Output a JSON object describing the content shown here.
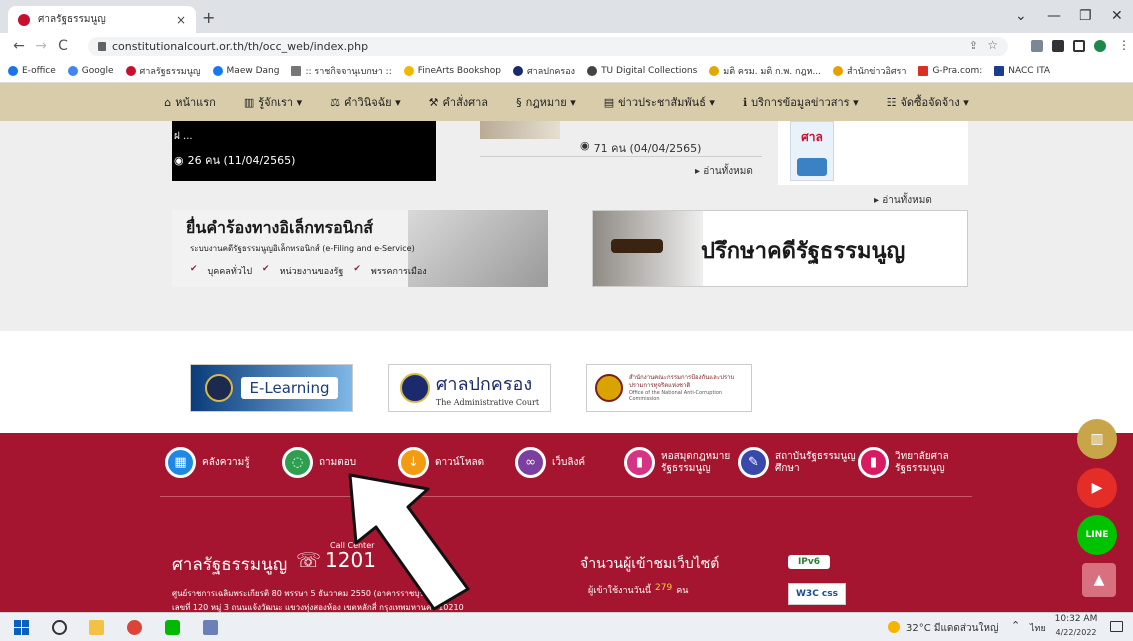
{
  "tab": {
    "title": "ศาลรัฐธรรมนูญ",
    "close": "×",
    "new": "+"
  },
  "window": {
    "minimize": "—",
    "restore": "❐",
    "close": "✕",
    "dropdown": "⌄"
  },
  "address": {
    "url": "constitutionalcourt.or.th/th/occ_web/index.php",
    "back": "←",
    "forward": "→",
    "reload": "C",
    "star": "☆",
    "share": "⇪"
  },
  "bookmarks": [
    {
      "label": "E-office",
      "color": "#1a73e8"
    },
    {
      "label": "Google",
      "color": "#4285f4"
    },
    {
      "label": "ศาลรัฐธรรมนูญ",
      "color": "#c8102e"
    },
    {
      "label": "Maew Dang",
      "color": "#1877f2"
    },
    {
      "label": ":: ราชกิจจานุเบกษา ::",
      "color": "#777777"
    },
    {
      "label": "FineArts Bookshop",
      "color": "#f2b700"
    },
    {
      "label": "ศาลปกครอง",
      "color": "#1a2a6c"
    },
    {
      "label": "TU Digital Collections",
      "color": "#444444"
    },
    {
      "label": "มติ ครม. มติ ก.พ. กฎห...",
      "color": "#e0a800"
    },
    {
      "label": "สำนักข่าวอิศรา",
      "color": "#e8a000"
    },
    {
      "label": "G-Pra.com:",
      "color": "#d93025"
    },
    {
      "label": "NACC ITA",
      "color": "#1a3d8f"
    }
  ],
  "menu": [
    {
      "label": "หน้าแรก",
      "icon": "home-icon",
      "glyph": "⌂"
    },
    {
      "label": "รู้จักเรา ▾",
      "icon": "building-icon",
      "glyph": "▥"
    },
    {
      "label": "คำวินิจฉัย ▾",
      "icon": "scales-icon",
      "glyph": "⚖"
    },
    {
      "label": "คำสั่งศาล",
      "icon": "gavel-icon",
      "glyph": "⚒"
    },
    {
      "label": "กฎหมาย ▾",
      "icon": "law-icon",
      "glyph": "§"
    },
    {
      "label": "ข่าวประชาสัมพันธ์ ▾",
      "icon": "news-icon",
      "glyph": "▤"
    },
    {
      "label": "บริการข้อมูลข่าวสาร ▾",
      "icon": "info-icon",
      "glyph": "ℹ"
    },
    {
      "label": "จัดซื้อจัดจ้าง ▾",
      "icon": "procure-icon",
      "glyph": "☷"
    }
  ],
  "news": {
    "left_views": "26 คน (11/04/2565)",
    "left_trunc": "ฝ ...",
    "mid_views": "71 คน (04/04/2565)",
    "mid_readmore": "▸ อ่านทั้งหมด",
    "right_readmore": "▸ อ่านทั้งหมด",
    "book_title": "ศาล"
  },
  "banner_left": {
    "title": "ยื่นคำร้องทางอิเล็กทรอนิกส์",
    "subtitle": "ระบบงานคดีรัฐธรรมนูญอิเล็กทรอนิกส์ (e-Filing and e-Service)",
    "opts": [
      "บุคคลทั่วไป",
      "หน่วยงานของรัฐ",
      "พรรคการเมือง"
    ]
  },
  "banner_right": {
    "title": "ปรึกษาคดีรัฐธรรมนูญ"
  },
  "logos": {
    "elearning": "E-Learning",
    "admin_th": "ศาลปกครอง",
    "admin_en": "The Administrative Court",
    "nacc_th": "สำนักงานคณะกรรมการป้องกันและปราบปรามการทุจริตแห่งชาติ",
    "nacc_en": "Office of the National Anti-Corruption Commission"
  },
  "quick": [
    {
      "label": "คลังความรู้",
      "color": "#1e88e5",
      "glyph": "▦"
    },
    {
      "label": "ถามตอบ",
      "color": "#2e9e4f",
      "glyph": "◌"
    },
    {
      "label": "ดาวน์โหลด",
      "color": "#f39c12",
      "glyph": "↓"
    },
    {
      "label": "เว็บลิงค์",
      "color": "#7b3fa0",
      "glyph": "∞"
    },
    {
      "label": "หอสมุดกฎหมายรัฐธรรมนูญ",
      "color": "#d63384",
      "glyph": "▮"
    },
    {
      "label": "สถาบันรัฐธรรมนูญศึกษา",
      "color": "#3949ab",
      "glyph": "✎"
    },
    {
      "label": "วิทยาลัยศาลรัฐธรรมนูญ",
      "color": "#d81b60",
      "glyph": "▮"
    }
  ],
  "footer": {
    "name": "ศาลรัฐธรรมนูญ",
    "callcenter_label": "Call Center",
    "callcenter_num": "1201",
    "addr1": "ศูนย์ราชการเฉลิมพระเกียรติ 80 พรรษา 5 ธันวาคม 2550 (อาคารราชบุรีดิเรกฤทธิ์)",
    "addr2": "เลขที่ 120 หมู่ 3 ถนนแจ้งวัฒนะ แขวงทุ่งสองห้อง เขตหลักสี่ กรุงเทพมหานคร 10210",
    "visitors_title": "จำนวนผู้เข้าชมเว็บไซต์",
    "visitors_today_label": "ผู้เข้าใช้งานวันนี้",
    "visitors_today": "279",
    "visitors_unit": "คน",
    "ipv6": "IPv6",
    "w3c": "W3C css"
  },
  "side_icons": [
    "magazine-icon",
    "youtube-icon",
    "line-icon",
    "scroll-top-icon"
  ],
  "side_text": {
    "line": "LINE",
    "top": "▲",
    "youtube": "▶"
  },
  "taskbar": {
    "weather": "32°C มีแดดส่วนใหญ่",
    "lang": "ไทย",
    "time": "10:32 AM",
    "date": "4/22/2022"
  }
}
